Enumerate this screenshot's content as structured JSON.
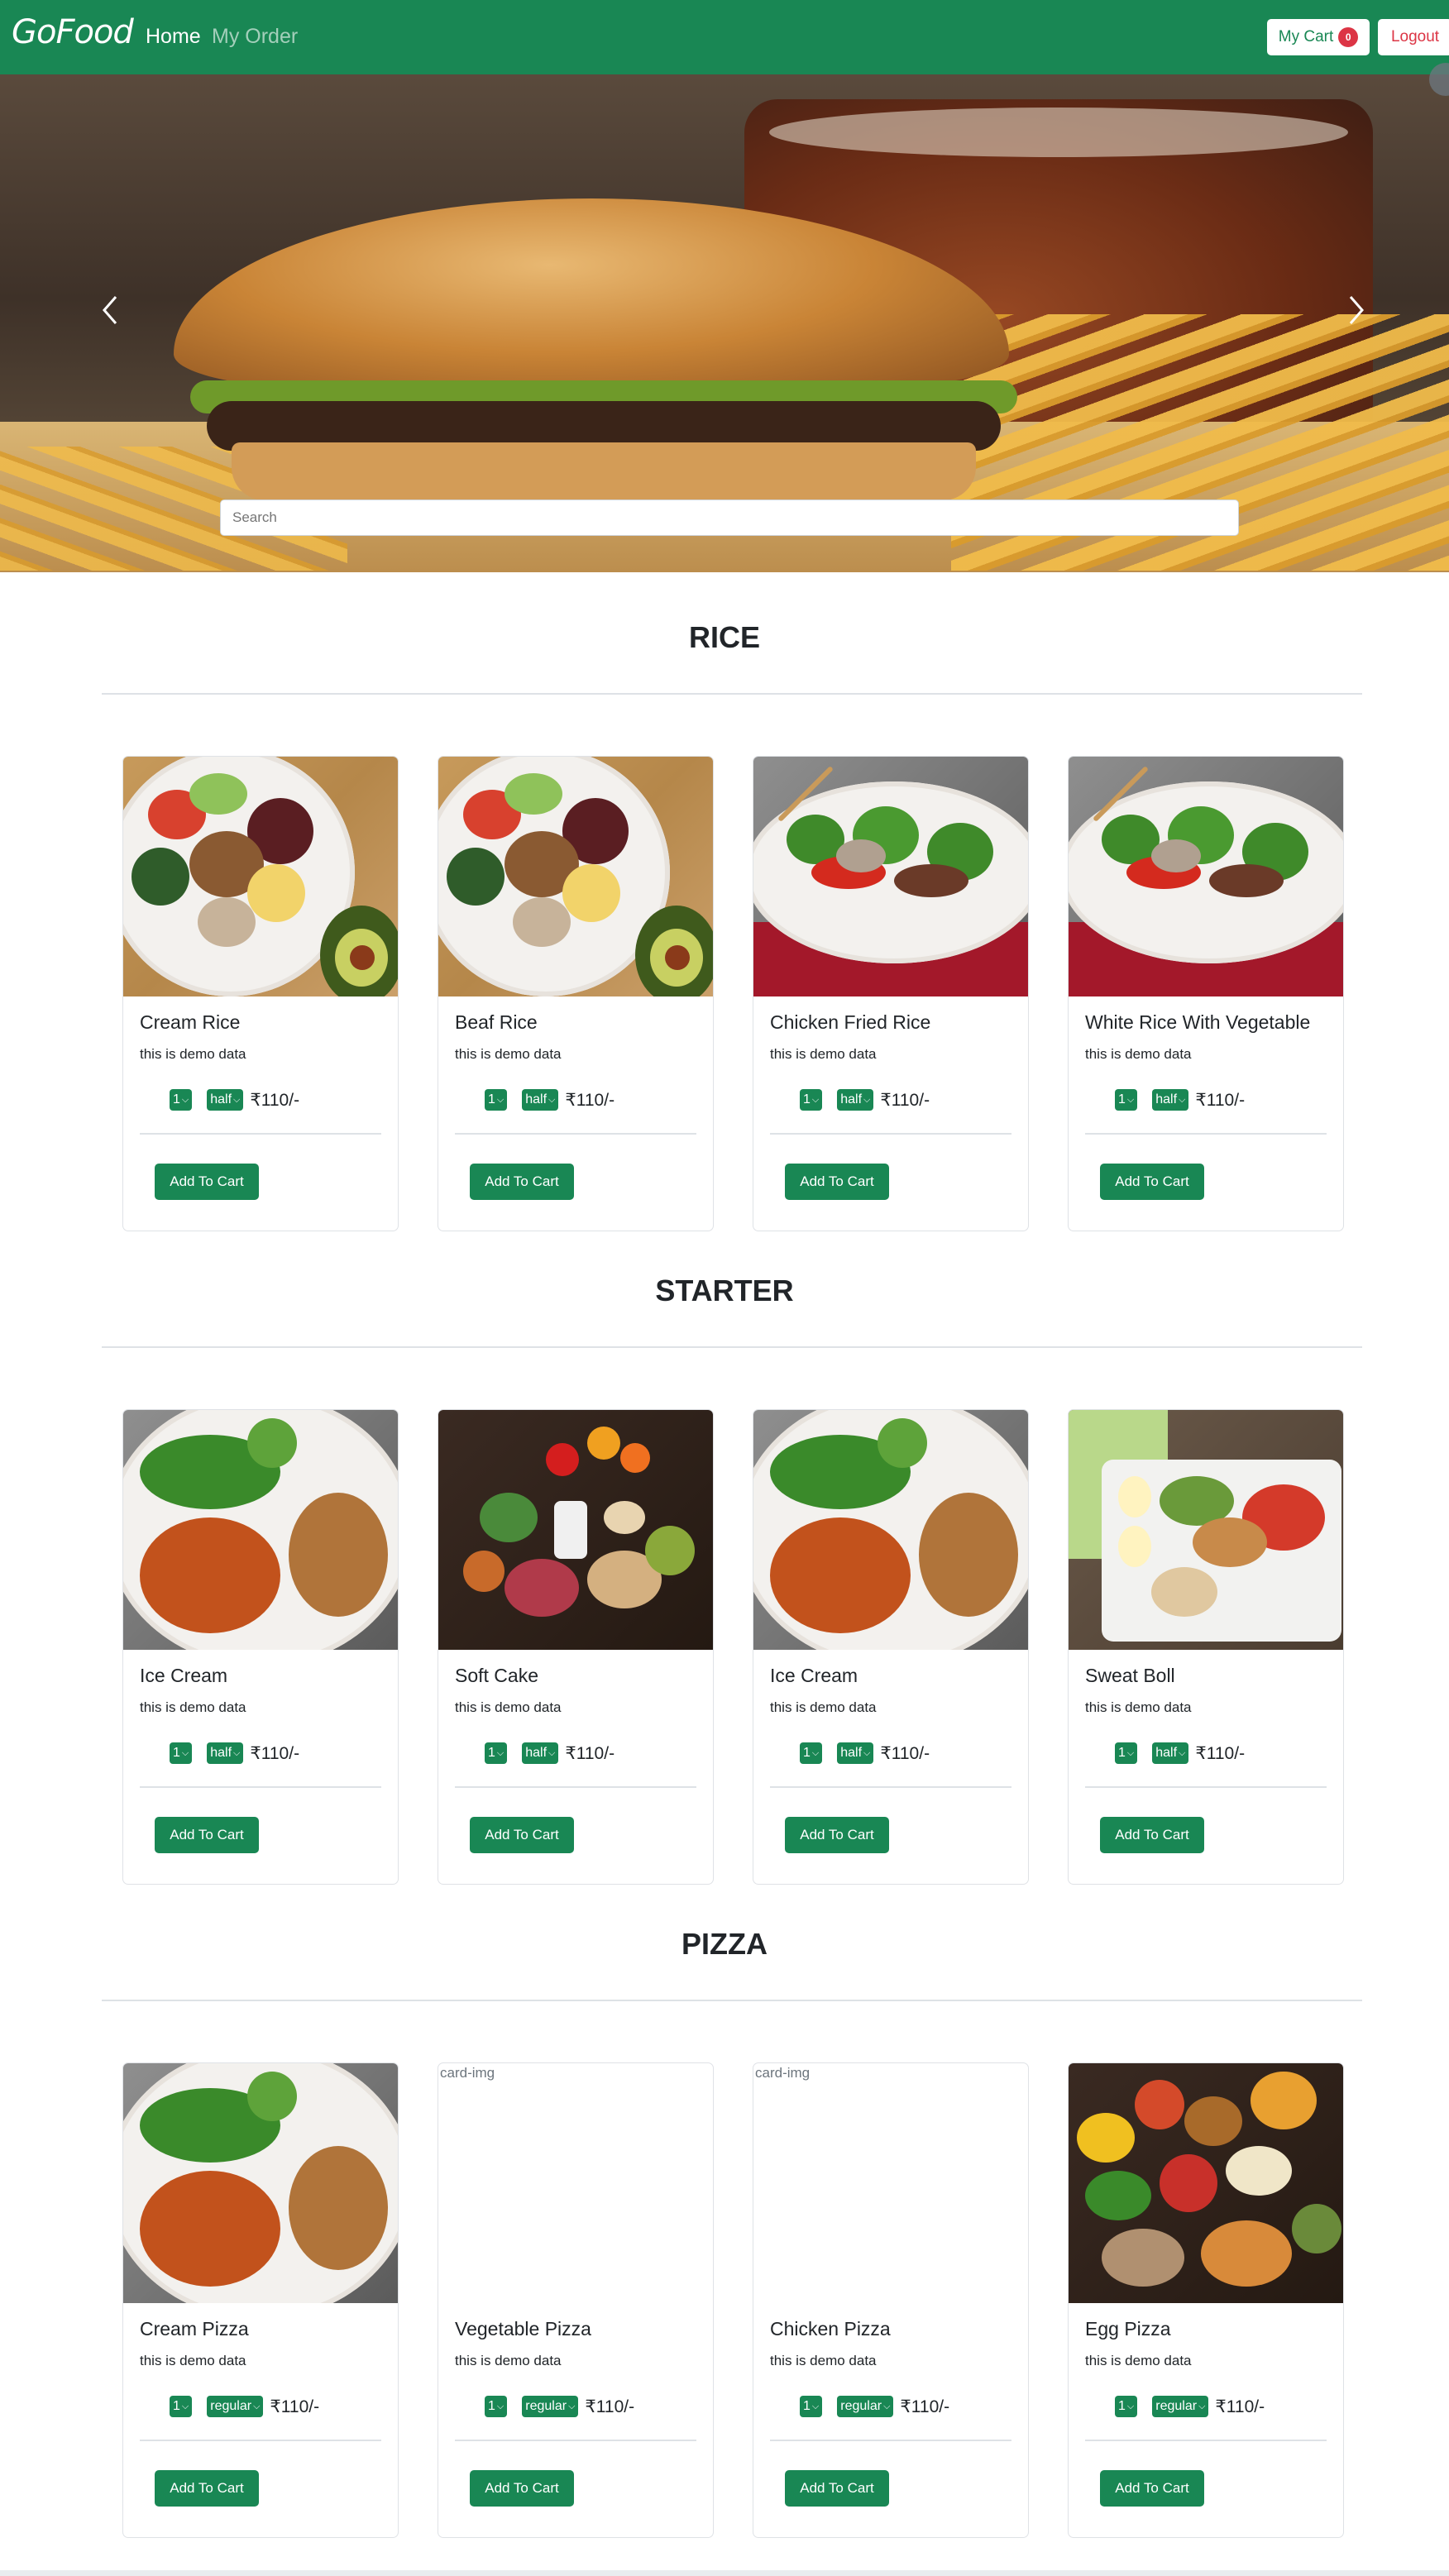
{
  "navbar": {
    "brand": "GoFood",
    "links": {
      "home": "Home",
      "my_order": "My Order"
    },
    "cart_label": "My Cart",
    "cart_count": "0",
    "logout_label": "Logout"
  },
  "search": {
    "placeholder": "Search"
  },
  "sections": [
    {
      "title": "RICE",
      "cards": [
        {
          "name": "Cream Rice",
          "desc": "this is demo data",
          "qty": "1",
          "size": "half",
          "price": "₹110/-",
          "button": "Add To Cart",
          "image": "rice-plate"
        },
        {
          "name": "Beaf Rice",
          "desc": "this is demo data",
          "qty": "1",
          "size": "half",
          "price": "₹110/-",
          "button": "Add To Cart",
          "image": "rice-plate"
        },
        {
          "name": "Chicken Fried Rice",
          "desc": "this is demo data",
          "qty": "1",
          "size": "half",
          "price": "₹110/-",
          "button": "Add To Cart",
          "image": "stir-fry-plate"
        },
        {
          "name": "White Rice With Vegetable",
          "desc": "this is demo data",
          "qty": "1",
          "size": "half",
          "price": "₹110/-",
          "button": "Add To Cart",
          "image": "stir-fry-plate"
        }
      ]
    },
    {
      "title": "STARTER",
      "cards": [
        {
          "name": "Ice Cream",
          "desc": "this is demo data",
          "qty": "1",
          "size": "half",
          "price": "₹110/-",
          "button": "Add To Cart",
          "image": "chicken-plate"
        },
        {
          "name": "Soft Cake",
          "desc": "this is demo data",
          "qty": "1",
          "size": "half",
          "price": "₹110/-",
          "button": "Add To Cart",
          "image": "groceries"
        },
        {
          "name": "Ice Cream",
          "desc": "this is demo data",
          "qty": "1",
          "size": "half",
          "price": "₹110/-",
          "button": "Add To Cart",
          "image": "chicken-plate"
        },
        {
          "name": "Sweat Boll",
          "desc": "this is demo data",
          "qty": "1",
          "size": "half",
          "price": "₹110/-",
          "button": "Add To Cart",
          "image": "salad-tray"
        }
      ]
    },
    {
      "title": "PIZZA",
      "cards": [
        {
          "name": "Cream Pizza",
          "desc": "this is demo data",
          "qty": "1",
          "size": "regular",
          "price": "₹110/-",
          "button": "Add To Cart",
          "image": "chicken-plate"
        },
        {
          "name": "Vegetable Pizza",
          "desc": "this is demo data",
          "qty": "1",
          "size": "regular",
          "price": "₹110/-",
          "button": "Add To Cart",
          "image": "broken",
          "alt": "card-img"
        },
        {
          "name": "Chicken Pizza",
          "desc": "this is demo data",
          "qty": "1",
          "size": "regular",
          "price": "₹110/-",
          "button": "Add To Cart",
          "image": "broken",
          "alt": "card-img"
        },
        {
          "name": "Egg Pizza",
          "desc": "this is demo data",
          "qty": "1",
          "size": "regular",
          "price": "₹110/-",
          "button": "Add To Cart",
          "image": "fruits-veg"
        }
      ]
    }
  ],
  "colors": {
    "primary": "#198754",
    "danger": "#dc3545",
    "text": "#212529",
    "divider": "#dee2e6"
  }
}
